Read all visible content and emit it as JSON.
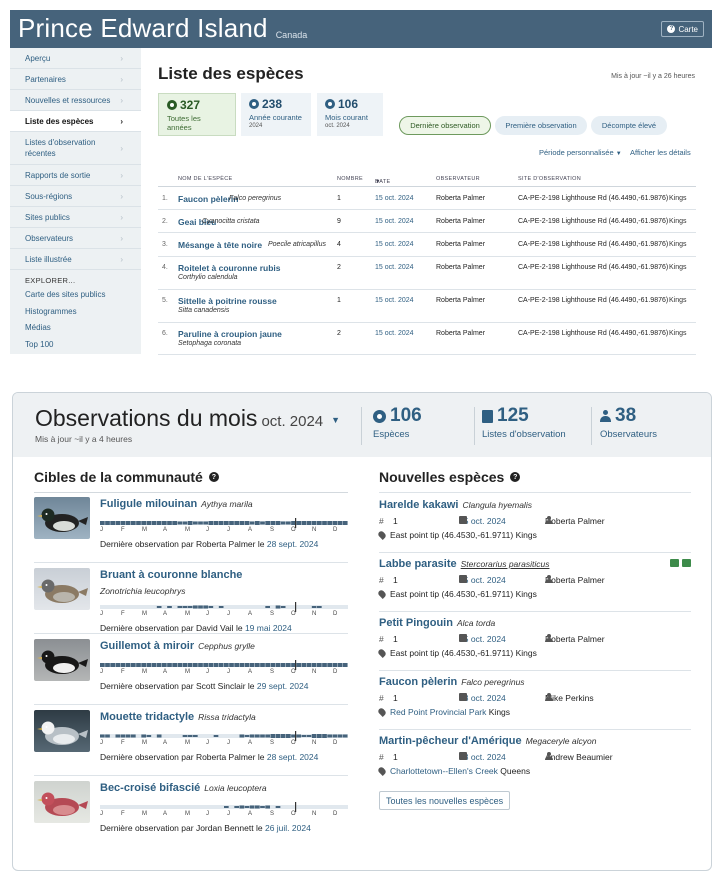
{
  "header": {
    "title": "Prince Edward Island",
    "region": "Canada",
    "map_button": "Carte"
  },
  "sidebar": {
    "items": [
      {
        "label": "Aperçu"
      },
      {
        "label": "Partenaires"
      },
      {
        "label": "Nouvelles et ressources"
      },
      {
        "label": "Liste des espèces",
        "active": true
      },
      {
        "label": "Listes d'observation récentes"
      },
      {
        "label": "Rapports de sortie"
      },
      {
        "label": "Sous-régions"
      },
      {
        "label": "Sites publics"
      },
      {
        "label": "Observateurs"
      },
      {
        "label": "Liste illustrée"
      }
    ],
    "explore_heading": "EXPLORER...",
    "explore_links": [
      "Carte des sites publics",
      "Histogrammes",
      "Médias",
      "Top 100"
    ]
  },
  "species_list": {
    "title": "Liste des espèces",
    "updated": "Mis à jour ~il y a 26 heures",
    "stats": [
      {
        "value": "327",
        "label": "Toutes les années",
        "sub": ""
      },
      {
        "value": "238",
        "label": "Année courante",
        "sub": "2024"
      },
      {
        "value": "106",
        "label": "Mois courant",
        "sub": "oct. 2024"
      }
    ],
    "sort_pills": [
      "Dernière observation",
      "Première observation",
      "Décompte élevé"
    ],
    "period_option": "Période personnalisée",
    "details_option": "Afficher les détails",
    "columns": [
      "NOM DE L'ESPÈCE",
      "NOMBRE",
      "DATE",
      "OBSERVATEUR",
      "SITE D'OBSERVATION"
    ],
    "rows": [
      {
        "idx": "1.",
        "common": "Faucon pèlerin",
        "sci": "Falco peregrinus",
        "count": "1",
        "date": "15 oct. 2024",
        "observer": "Roberta Palmer",
        "site": "CA-PE-2-198 Lighthouse Rd (46.4490,-61.9876)",
        "county": "Kings"
      },
      {
        "idx": "2.",
        "common": "Geai bleu",
        "sci": "Cyanocitta cristata",
        "count": "9",
        "date": "15 oct. 2024",
        "observer": "Roberta Palmer",
        "site": "CA-PE-2-198 Lighthouse Rd (46.4490,-61.9876)",
        "county": "Kings"
      },
      {
        "idx": "3.",
        "common": "Mésange à tête noire",
        "sci": "Poecile atricapillus",
        "count": "4",
        "date": "15 oct. 2024",
        "observer": "Roberta Palmer",
        "site": "CA-PE-2-198 Lighthouse Rd (46.4490,-61.9876)",
        "county": "Kings"
      },
      {
        "idx": "4.",
        "common": "Roitelet à couronne rubis",
        "sci": "Corthylio calendula",
        "count": "2",
        "date": "15 oct. 2024",
        "observer": "Roberta Palmer",
        "site": "CA-PE-2-198 Lighthouse Rd (46.4490,-61.9876)",
        "county": "Kings"
      },
      {
        "idx": "5.",
        "common": "Sittelle à poitrine rousse",
        "sci": "Sitta canadensis",
        "count": "1",
        "date": "15 oct. 2024",
        "observer": "Roberta Palmer",
        "site": "CA-PE-2-198 Lighthouse Rd (46.4490,-61.9876)",
        "county": "Kings"
      },
      {
        "idx": "6.",
        "common": "Paruline à croupion jaune",
        "sci": "Setophaga coronata",
        "count": "2",
        "date": "15 oct. 2024",
        "observer": "Roberta Palmer",
        "site": "CA-PE-2-198 Lighthouse Rd (46.4490,-61.9876)",
        "county": "Kings"
      }
    ]
  },
  "month_panel": {
    "title": "Observations du mois",
    "month": "oct. 2024",
    "updated": "Mis à jour ~il y a 4 heures",
    "stats": [
      {
        "value": "106",
        "label": "Espèces"
      },
      {
        "value": "125",
        "label": "Listes d'observation"
      },
      {
        "value": "38",
        "label": "Observateurs"
      }
    ],
    "targets_title": "Cibles de la communauté",
    "month_letters": [
      "J",
      "F",
      "M",
      "A",
      "M",
      "J",
      "J",
      "A",
      "S",
      "O",
      "N",
      "D"
    ],
    "last_seen_prefix": "Dernière observation par",
    "last_seen_joiner": "le",
    "targets": [
      {
        "common": "Fuligule milouinan",
        "sci": "Aythya marila",
        "by": "Roberta Palmer",
        "date": "28 sept. 2024",
        "image": "scaup-photo"
      },
      {
        "common": "Bruant à couronne blanche",
        "sci": "Zonotrichia leucophrys",
        "by": "David Vail",
        "date": "19 mai 2024",
        "image": "sparrow-photo"
      },
      {
        "common": "Guillemot à miroir",
        "sci": "Cepphus grylle",
        "by": "Scott Sinclair",
        "date": "29 sept. 2024",
        "image": "guillemot-photo"
      },
      {
        "common": "Mouette tridactyle",
        "sci": "Rissa tridactyla",
        "by": "Roberta Palmer",
        "date": "28 sept. 2024",
        "image": "kittiwake-photo"
      },
      {
        "common": "Bec-croisé bifascié",
        "sci": "Loxia leucoptera",
        "by": "Jordan Bennett",
        "date": "26 juil. 2024",
        "image": "crossbill-photo"
      }
    ],
    "new_title": "Nouvelles espèces",
    "new_species": [
      {
        "common": "Harelde kakawi",
        "sci": "Clangula hyemalis",
        "count": "1",
        "date": "15 oct. 2024",
        "observer": "Roberta Palmer",
        "location": "East point tip (46.4530,-61.9711)",
        "county": "Kings",
        "location_link": false
      },
      {
        "common": "Labbe parasite",
        "sci": "Stercorarius parasiticus",
        "count": "1",
        "date": "15 oct. 2024",
        "observer": "Roberta Palmer",
        "location": "East point tip (46.4530,-61.9711)",
        "county": "Kings",
        "location_link": false,
        "media": true
      },
      {
        "common": "Petit Pingouin",
        "sci": "Alca torda",
        "count": "1",
        "date": "15 oct. 2024",
        "observer": "Roberta Palmer",
        "location": "East point tip (46.4530,-61.9711)",
        "county": "Kings",
        "location_link": false
      },
      {
        "common": "Faucon pèlerin",
        "sci": "Falco peregrinus",
        "count": "1",
        "date": "13 oct. 2024",
        "observer": "Mike Perkins",
        "location": "Red Point Provincial Park",
        "county": "Kings",
        "location_link": true
      },
      {
        "common": "Martin-pêcheur d'Amérique",
        "sci": "Megaceryle alcyon",
        "count": "1",
        "date": "13 oct. 2024",
        "observer": "Andrew Beaumier",
        "location": "Charlottetown--Ellen's Creek",
        "county": "Queens",
        "location_link": true
      }
    ],
    "all_new_button": "Toutes les nouvelles espèces"
  },
  "colors": {
    "header_bg": "#46637b",
    "link": "#2f5f82",
    "selected_green": "#e8f3e3",
    "bar": "#46637b"
  }
}
